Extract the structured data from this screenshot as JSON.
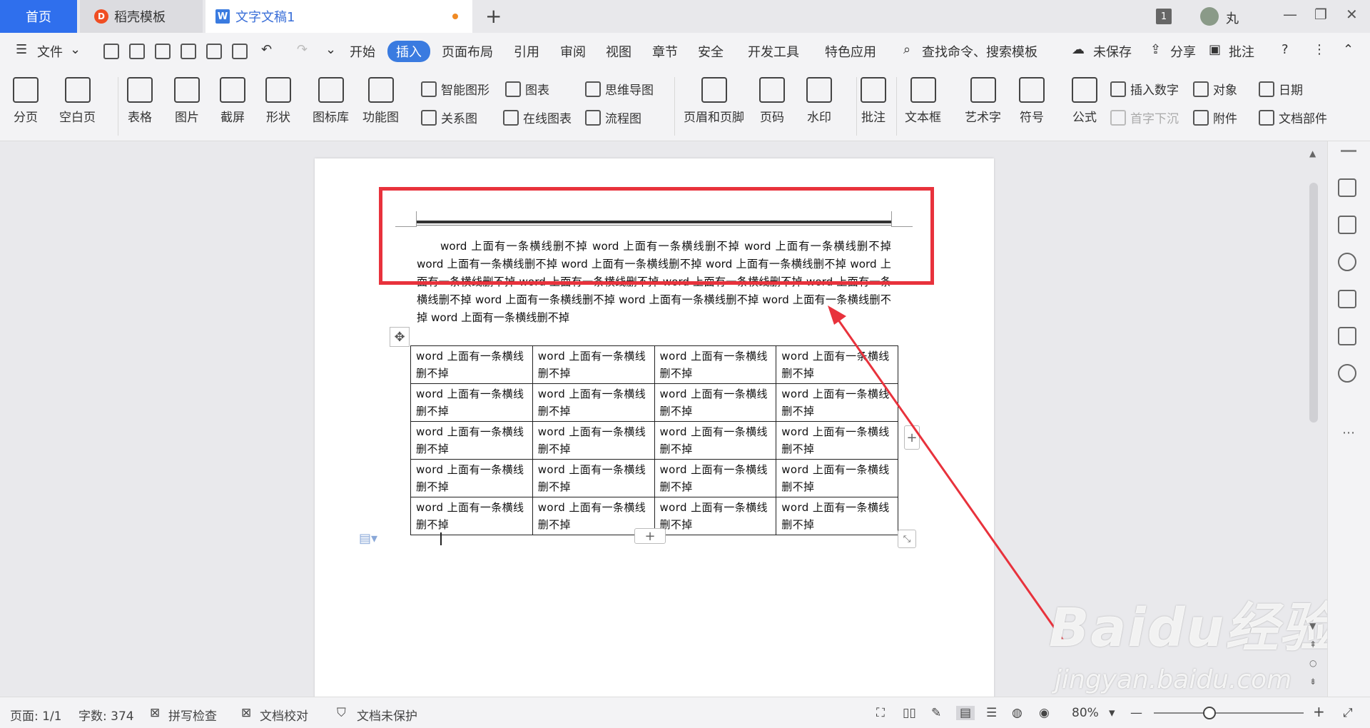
{
  "tabs": {
    "home": "首页",
    "daoke": "稻壳模板",
    "doc": "文字文稿1",
    "new": "+"
  },
  "titlebar": {
    "badge": "1",
    "user": "丸",
    "min": "—",
    "restore": "❐",
    "close": "✕"
  },
  "menu": {
    "file": "文件",
    "items": [
      "开始",
      "插入",
      "页面布局",
      "引用",
      "审阅",
      "视图",
      "章节",
      "安全",
      "开发工具",
      "特色应用"
    ],
    "active": "插入",
    "search": "查找命令、搜索模板",
    "unsaved": "未保存",
    "share": "分享",
    "comment": "批注"
  },
  "ribbon": {
    "page_break": "分页",
    "blank_page": "空白页",
    "table": "表格",
    "picture": "图片",
    "screenshot": "截屏",
    "shape": "形状",
    "icon_lib": "图标库",
    "func_chart": "功能图",
    "smart_shape": "智能图形",
    "chart": "图表",
    "mindmap": "思维导图",
    "relation": "关系图",
    "online_chart": "在线图表",
    "flowchart": "流程图",
    "header_footer": "页眉和页脚",
    "page_num": "页码",
    "watermark": "水印",
    "annotation": "批注",
    "textbox": "文本框",
    "wordart": "艺术字",
    "symbol": "符号",
    "formula": "公式",
    "insert_number": "插入数字",
    "object": "对象",
    "date": "日期",
    "drop_cap": "首字下沉",
    "attachment": "附件",
    "doc_parts": "文档部件"
  },
  "document": {
    "paragraph": "word 上面有一条横线删不掉 word 上面有一条横线删不掉 word 上面有一条横线删不掉 word 上面有一条横线删不掉 word 上面有一条横线删不掉 word 上面有一条横线删不掉 word 上面有一条横线删不掉 word 上面有一条横线删不掉 word 上面有一条横线删不掉 word 上面有一条横线删不掉 word 上面有一条横线删不掉 word 上面有一条横线删不掉 word 上面有一条横线删不掉 word 上面有一条横线删不掉",
    "table": [
      [
        "word 上面有一条横线删不掉",
        "word 上面有一条横线删不掉",
        "word 上面有一条横线删不掉",
        "word 上面有一条横线删不掉"
      ],
      [
        "word 上面有一条横线删不掉",
        "word 上面有一条横线删不掉",
        "word 上面有一条横线删不掉",
        "word 上面有一条横线删不掉"
      ],
      [
        "word 上面有一条横线删不掉",
        "word 上面有一条横线删不掉",
        "word 上面有一条横线删不掉",
        "word 上面有一条横线删不掉"
      ],
      [
        "word 上面有一条横线删不掉",
        "word 上面有一条横线删不掉",
        "word 上面有一条横线删不掉",
        "word 上面有一条横线删不掉"
      ],
      [
        "word 上面有一条横线删不掉",
        "word 上面有一条横线删不掉",
        "word 上面有一条横线删不掉",
        "word 上面有一条横线删不掉"
      ]
    ]
  },
  "status": {
    "page": "页面: 1/1",
    "words": "字数: 374",
    "spell": "拼写检查",
    "proof": "文档校对",
    "protect": "文档未保护",
    "zoom": "80%"
  },
  "watermark": {
    "brand": "Baidu经验",
    "url": "jingyan.baidu.com"
  },
  "colors": {
    "accent": "#3a7be0",
    "annotation": "#e8323c"
  }
}
